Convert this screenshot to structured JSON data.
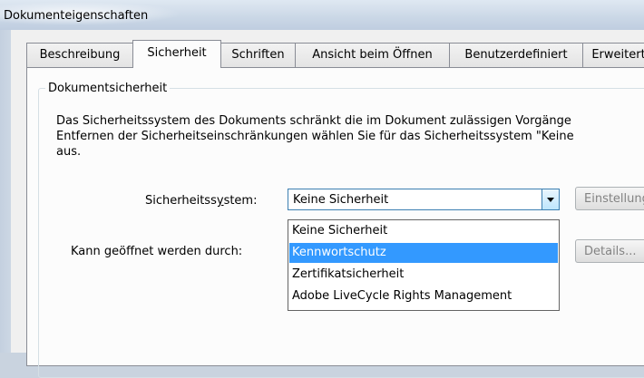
{
  "window": {
    "title": "Dokumenteigenschaften"
  },
  "tabs": [
    {
      "label": "Beschreibung"
    },
    {
      "label": "Sicherheit"
    },
    {
      "label": "Schriften"
    },
    {
      "label": "Ansicht beim Öffnen"
    },
    {
      "label": "Benutzerdefiniert"
    },
    {
      "label": "Erweitert"
    }
  ],
  "active_tab": "Sicherheit",
  "section": {
    "title": "Dokumentsicherheit",
    "description": [
      "Das Sicherheitssystem des Dokuments schränkt die im Dokument zulässigen Vorgänge",
      "Entfernen der Sicherheitseinschränkungen wählen Sie für das Sicherheitssystem \"Keine",
      "aus."
    ]
  },
  "security_system": {
    "label_pre": "Sicherheitss",
    "label_mnemonic": "y",
    "label_post": "stem:",
    "selected": "Keine Sicherheit",
    "options": [
      "Keine Sicherheit",
      "Kennwortschutz",
      "Zertifikatsicherheit",
      "Adobe LiveCycle Rights Management"
    ],
    "highlighted_option": "Kennwortschutz"
  },
  "open_by": {
    "label": "Kann geöffnet werden durch:"
  },
  "buttons": {
    "settings": "Einstellungen...",
    "details": "Details..."
  }
}
